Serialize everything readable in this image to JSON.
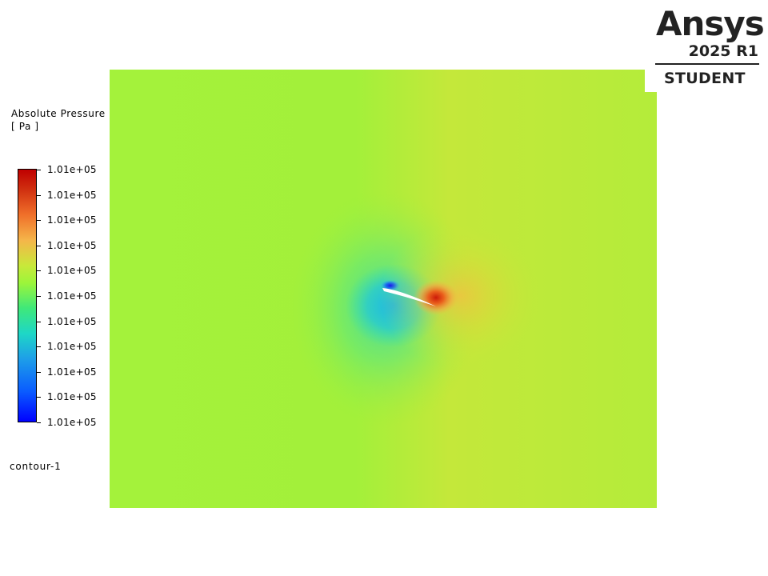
{
  "logo": {
    "brand": "Ansys",
    "version": "2025 R1",
    "edition": "STUDENT"
  },
  "legend": {
    "title_line1": "Absolute Pressure",
    "title_line2": "[ Pa ]",
    "ticks": [
      "1.01e+05",
      "1.01e+05",
      "1.01e+05",
      "1.01e+05",
      "1.01e+05",
      "1.01e+05",
      "1.01e+05",
      "1.01e+05",
      "1.01e+05",
      "1.01e+05",
      "1.01e+05"
    ]
  },
  "contour_name": "contour-1",
  "chart_data": {
    "type": "heatmap",
    "variable": "Absolute Pressure",
    "units": "Pa",
    "colormap": "rainbow",
    "colorbar_tick_labels": [
      "1.01e+05",
      "1.01e+05",
      "1.01e+05",
      "1.01e+05",
      "1.01e+05",
      "1.01e+05",
      "1.01e+05",
      "1.01e+05",
      "1.01e+05",
      "1.01e+05",
      "1.01e+05"
    ],
    "legend_placement": "left",
    "field_description_colors": {
      "background": "#a6f03a",
      "suction_peak": "#0000ff",
      "stagnation_peak": "#d42a0a",
      "airfoil": "#ffffff"
    },
    "grid": false
  }
}
